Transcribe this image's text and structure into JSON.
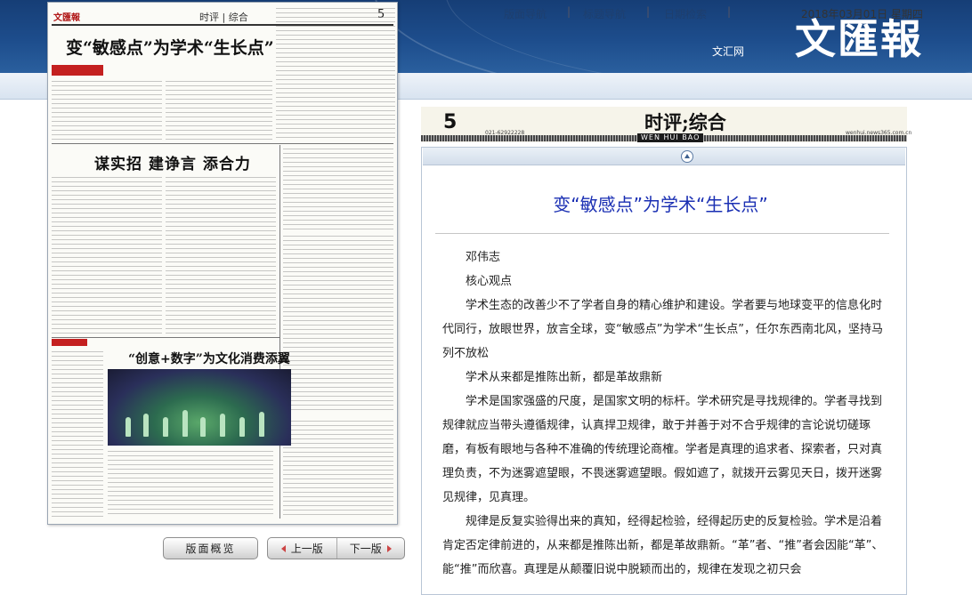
{
  "banner": {
    "site_name": "文汇网",
    "brand": "文匯報"
  },
  "nav": {
    "items": [
      {
        "label": "版面导航"
      },
      {
        "label": "标题导航"
      },
      {
        "label": "日期检索"
      }
    ],
    "separator": "|",
    "date": "2018年03月01日 星期四"
  },
  "thumbnail": {
    "logo": "文匯報",
    "section": "时评 | 综合",
    "page_num": "5",
    "headline": "变“敏感点”为学术“生长点”",
    "headline2": "谋实招  建诤言  添合力",
    "headline3": "“创意+数字”为文化消费添翼"
  },
  "buttons": {
    "overview": "版面概览",
    "prev": "上一版",
    "next": "下一版"
  },
  "section_strip": {
    "page_num": "5",
    "title": "时评;综合",
    "english": "WEN HUI BAO",
    "phone": "021-62922228",
    "web": "wenhui.news365.com.cn"
  },
  "article": {
    "title": "变“敏感点”为学术“生长点”",
    "paragraphs": [
      "邓伟志",
      "核心观点",
      "学术生态的改善少不了学者自身的精心维护和建设。学者要与地球变平的信息化时代同行，放眼世界，放言全球，变“敏感点”为学术“生长点”，任尔东西南北风，坚持马列不放松",
      "学术从来都是推陈出新，都是革故鼎新",
      "学术是国家强盛的尺度，是国家文明的标杆。学术研究是寻找规律的。学者寻找到规律就应当带头遵循规律，认真捍卫规律，敢于并善于对不合乎规律的言论说切磋琢磨，有板有眼地与各种不准确的传统理论商榷。学者是真理的追求者、探索者，只对真理负责，不为迷雾遮望眼，不畏迷雾遮望眼。假如遮了，就拨开云雾见天日，拨开迷雾见规律，见真理。",
      "规律是反复实验得出来的真知，经得起检验，经得起历史的反复检验。学术是沿着肯定否定律前进的，从来都是推陈出新，都是革故鼎新。“革”者、“推”者会因能“革”、能“推”而欣喜。真理是从颠覆旧说中脱颖而出的，规律在发现之初只会"
    ]
  }
}
